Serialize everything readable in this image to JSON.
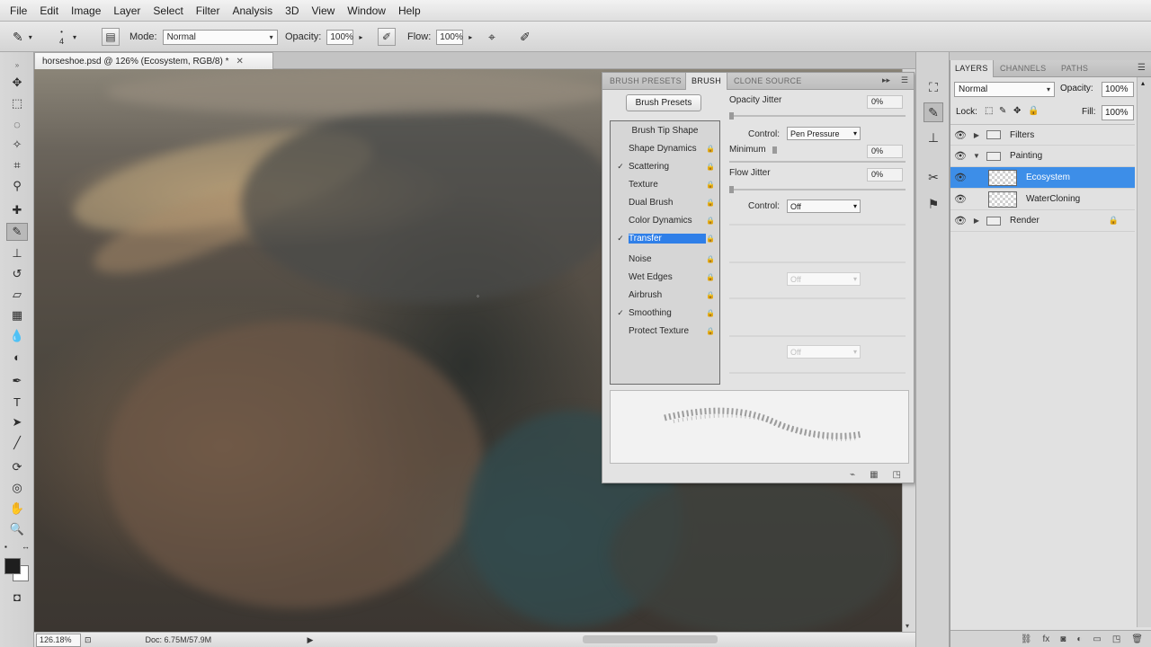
{
  "menu": [
    "File",
    "Edit",
    "Image",
    "Layer",
    "Select",
    "Filter",
    "Analysis",
    "3D",
    "View",
    "Window",
    "Help"
  ],
  "options": {
    "brush_size": "4",
    "mode_label": "Mode:",
    "mode_value": "Normal",
    "opacity_label": "Opacity:",
    "opacity_value": "100%",
    "flow_label": "Flow:",
    "flow_value": "100%"
  },
  "document": {
    "tab_title": "horseshoe.psd @ 126% (Ecosystem, RGB/8) *",
    "zoom": "126.18%",
    "doc_info": "Doc: 6.75M/57.9M"
  },
  "brush_panel": {
    "tabs": [
      "BRUSH PRESETS",
      "BRUSH",
      "CLONE SOURCE"
    ],
    "active_tab": "BRUSH",
    "presets_button": "Brush Presets",
    "list_header": "Brush Tip Shape",
    "options": [
      {
        "label": "Shape Dynamics",
        "checked": false
      },
      {
        "label": "Scattering",
        "checked": true
      },
      {
        "label": "Texture",
        "checked": false
      },
      {
        "label": "Dual Brush",
        "checked": false
      },
      {
        "label": "Color Dynamics",
        "checked": false
      },
      {
        "label": "Transfer",
        "checked": true,
        "selected": true
      },
      {
        "label": "Noise",
        "checked": false
      },
      {
        "label": "Wet Edges",
        "checked": false
      },
      {
        "label": "Airbrush",
        "checked": false
      },
      {
        "label": "Smoothing",
        "checked": true
      },
      {
        "label": "Protect Texture",
        "checked": false
      }
    ],
    "opacity_jitter_label": "Opacity Jitter",
    "opacity_jitter_value": "0%",
    "control_label": "Control:",
    "control_value": "Pen Pressure",
    "minimum_label": "Minimum",
    "minimum_value": "0%",
    "flow_jitter_label": "Flow Jitter",
    "flow_jitter_value": "0%",
    "control2_label": "Control:",
    "control2_value": "Off",
    "disabled_control_value": "Off",
    "disabled_control_value2": "Off"
  },
  "layers_panel": {
    "tabs": [
      "LAYERS",
      "CHANNELS",
      "PATHS"
    ],
    "blend_mode": "Normal",
    "opacity_label": "Opacity:",
    "opacity_value": "100%",
    "lock_label": "Lock:",
    "fill_label": "Fill:",
    "fill_value": "100%",
    "layers": [
      {
        "name": "Filters",
        "type": "group",
        "expanded": false
      },
      {
        "name": "Painting",
        "type": "group",
        "expanded": true
      },
      {
        "name": "Ecosystem",
        "type": "layer",
        "selected": true
      },
      {
        "name": "WaterCloning",
        "type": "layer"
      },
      {
        "name": "Render",
        "type": "group",
        "expanded": false,
        "locked": true
      }
    ]
  },
  "colors": {
    "selection_blue": "#2f7fe8",
    "foreground": "#1e1e1e",
    "background": "#ffffff"
  }
}
